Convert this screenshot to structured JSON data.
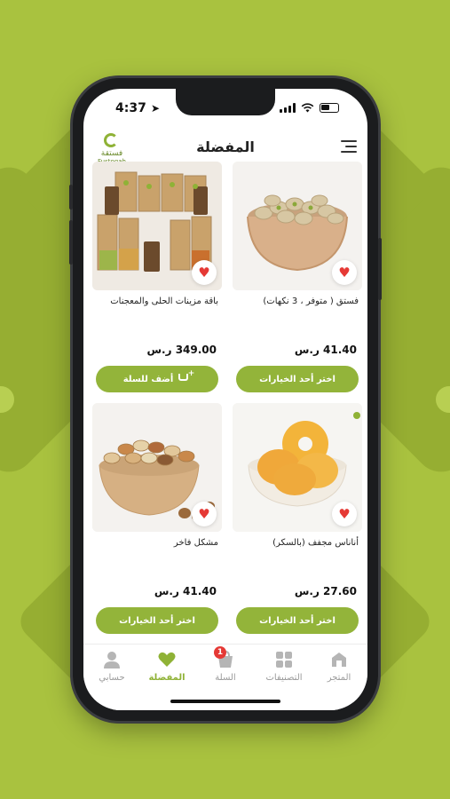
{
  "status_bar": {
    "time": "4:37"
  },
  "header": {
    "title": "المفضلة",
    "logo_ar": "فستقة",
    "logo_en": "Fustoqah"
  },
  "products": [
    {
      "name": "فستق ( متوفر ، 3 نكهات)",
      "price": "41.40 ر.س",
      "button": "اختر أحد الخيارات",
      "image": "pistachio-bowl"
    },
    {
      "name": "باقة مزينات الحلى والمعجنات",
      "price": "349.00 ر.س",
      "button": "أضف للسلة",
      "image": "gift-bundle"
    },
    {
      "name": "أناناس مجفف (بالسكر)",
      "price": "27.60 ر.س",
      "button": "اختر أحد الخيارات",
      "image": "dried-pineapple"
    },
    {
      "name": "مشكل فاخر",
      "price": "41.40 ر.س",
      "button": "اختر أحد الخيارات",
      "image": "mixed-nuts"
    }
  ],
  "tabbar": {
    "items": [
      {
        "label": "المتجر",
        "icon": "store-icon"
      },
      {
        "label": "التصنيفات",
        "icon": "categories-icon"
      },
      {
        "label": "السلة",
        "icon": "cart-icon",
        "badge": "1"
      },
      {
        "label": "المفضلة",
        "icon": "heart-icon",
        "active": true
      },
      {
        "label": "حسابي",
        "icon": "user-icon"
      }
    ]
  },
  "colors": {
    "accent": "#93b43a",
    "background": "#a9c23f",
    "heart": "#e53935"
  }
}
